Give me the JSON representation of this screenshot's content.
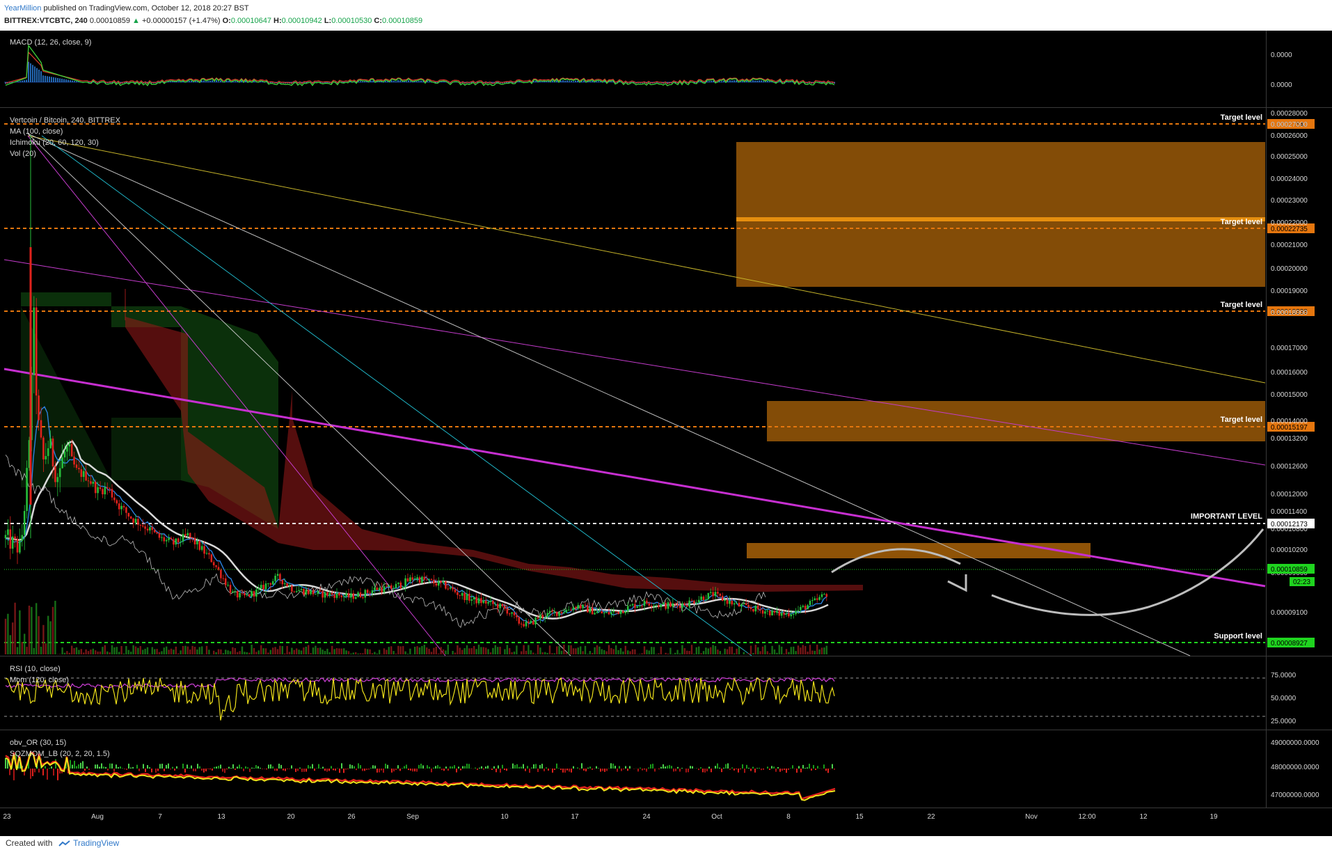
{
  "header": {
    "author": "YearMillion",
    "published": "published on TradingView.com, October 12, 2018 20:27 BST",
    "symbol": "BITTREX:VTCBTC, 240",
    "last": "0.00010859",
    "change": "+0.00000157 (+1.47%)",
    "open_label": "O:",
    "open": "0.00010647",
    "high_label": "H:",
    "high": "0.00010942",
    "low_label": "L:",
    "low": "0.00010530",
    "close_label": "C:",
    "close": "0.00010859"
  },
  "legend": {
    "macd": "MACD (12, 26, close, 9)",
    "pair": "Vertcoin / Bitcoin, 240, BITTREX",
    "ma": "MA (100, close)",
    "ichimoku": "Ichimoku (20, 60, 120, 30)",
    "vol": "Vol (20)",
    "rsi": "RSI (10, close)",
    "mom": "Mom (120, close)",
    "obv": "obv_OR (30, 15)",
    "sqz": "SQZMOM_LB (20, 2, 20, 1.5)"
  },
  "macd_axis": [
    "0.0000",
    "0.0000"
  ],
  "price_axis": {
    "ticks": [
      "0.00028000",
      "0.00027000",
      "0.00026000",
      "0.00025000",
      "0.00024000",
      "0.00023000",
      "0.00022000",
      "0.00021000",
      "0.00020000",
      "0.00019000",
      "0.00018000",
      "0.00017000",
      "0.00016000",
      "0.00015000",
      "0.00014000",
      "0.00013200",
      "0.00012600",
      "0.00012000",
      "0.00011400",
      "0.00010800",
      "0.00010200",
      "0.00009600",
      "0.00009100"
    ]
  },
  "rsi_axis": [
    "75.0000",
    "50.0000",
    "25.0000"
  ],
  "obv_axis": [
    "49000000.0000",
    "48000000.0000",
    "47000000.0000"
  ],
  "x_axis": [
    "23",
    "Aug",
    "7",
    "13",
    "20",
    "26",
    "Sep",
    "10",
    "17",
    "24",
    "Oct",
    "8",
    "15",
    "22",
    "Nov",
    "12:00",
    "12",
    "19"
  ],
  "levels": [
    {
      "label": "Target level",
      "value": "0.00027540",
      "color": "#e5760e"
    },
    {
      "label": "Target level",
      "value": "0.00022735",
      "color": "#e5760e"
    },
    {
      "label": "Target level",
      "value": "0.00019338",
      "color": "#e5760e"
    },
    {
      "label": "Target level",
      "value": "0.00015197",
      "color": "#e5760e"
    },
    {
      "label": "IMPORTANT LEVEL",
      "value": "0.00012173",
      "color": "#ffffff"
    },
    {
      "label": "Support level",
      "value": "0.00008927",
      "color": "#1fd41f"
    }
  ],
  "current_price": {
    "value": "0.00010859",
    "countdown": "02:23",
    "color": "#1fd41f"
  },
  "footer": {
    "created": "Created with",
    "brand": "TradingView"
  },
  "chart_data": {
    "type": "line",
    "symbol": "BITTREX:VTCBTC",
    "timeframe": "240",
    "x": [
      "Jul 23",
      "Aug 1",
      "Aug 7",
      "Aug 13",
      "Aug 20",
      "Aug 26",
      "Sep 1",
      "Sep 10",
      "Sep 17",
      "Sep 24",
      "Oct 1",
      "Oct 8",
      "Oct 12"
    ],
    "series": [
      {
        "name": "Vertcoin / Bitcoin",
        "values": [
          0.000128,
          0.00015,
          0.000138,
          0.000108,
          0.00011,
          0.000108,
          0.000114,
          9.6e-05,
          0.000101,
          0.000103,
          0.000106,
          0.0001,
          0.0001086
        ]
      },
      {
        "name": "MA (100, close)",
        "values": [
          0.00014,
          0.000146,
          0.000143,
          0.00013,
          0.000118,
          0.00011,
          0.000108,
          0.000107,
          0.000105,
          0.000104,
          0.000104,
          0.000103,
          0.000104
        ]
      }
    ],
    "ylim": [
      8.8e-05,
      0.00028
    ]
  },
  "colors": {
    "bg": "#000000",
    "up": "#26c03a",
    "down": "#e0221c",
    "ma": "#d9d9d9",
    "tenkan": "#2c82e0",
    "rsi": "#f0e21a",
    "mom": "#c43ccc",
    "zone": "#ef8a0c"
  }
}
